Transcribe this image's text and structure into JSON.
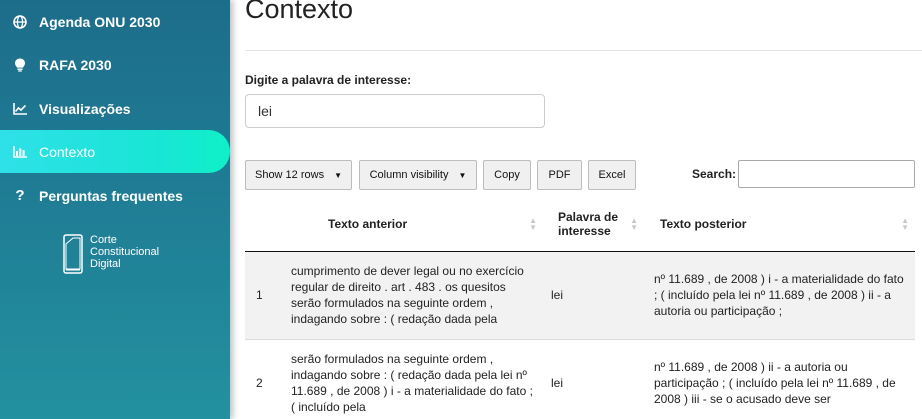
{
  "sidebar": {
    "items": [
      {
        "label": "Agenda ONU 2030",
        "icon": "globe-icon"
      },
      {
        "label": "RAFA 2030",
        "icon": "lightbulb-icon"
      },
      {
        "label": "Visualizações",
        "icon": "line-chart-icon"
      },
      {
        "label": "Contexto",
        "icon": "bar-chart-icon",
        "active": true
      },
      {
        "label": "Perguntas frequentes",
        "icon": "question-icon"
      }
    ],
    "logo": {
      "line1": "Corte",
      "line2": "Constitucional",
      "line3": "Digital"
    }
  },
  "main": {
    "title": "Contexto",
    "input_label": "Digite a palavra de interesse:",
    "input_value": "lei",
    "buttons": {
      "show_rows": "Show 12 rows",
      "column_visibility": "Column visibility",
      "copy": "Copy",
      "pdf": "PDF",
      "excel": "Excel"
    },
    "search_label": "Search:",
    "table": {
      "headers": [
        "",
        "Texto anterior",
        "Palavra de interesse",
        "Texto posterior"
      ],
      "rows": [
        {
          "index": "1",
          "anterior": "cumprimento de dever legal ou no exercício regular de direito . art . 483 . os quesitos serão formulados na seguinte ordem , indagando sobre : ( redação dada pela",
          "palavra": "lei",
          "posterior": "nº 11.689 , de 2008 ) i - a materialidade do fato ; ( incluído pela lei nº 11.689 , de 2008 ) ii - a autoria ou participação ;"
        },
        {
          "index": "2",
          "anterior": "serão formulados na seguinte ordem , indagando sobre : ( redação dada pela lei nº 11.689 , de 2008 ) i - a materialidade do fato ; ( incluído pela",
          "palavra": "lei",
          "posterior": "nº 11.689 , de 2008 ) ii - a autoria ou participação ; ( incluído pela lei nº 11.689 , de 2008 ) iii - se o acusado deve ser"
        }
      ]
    }
  },
  "colors": {
    "sidebar": "#1f7c94",
    "active": "#18e6d4",
    "row_stripe": "#f2f2f2"
  }
}
